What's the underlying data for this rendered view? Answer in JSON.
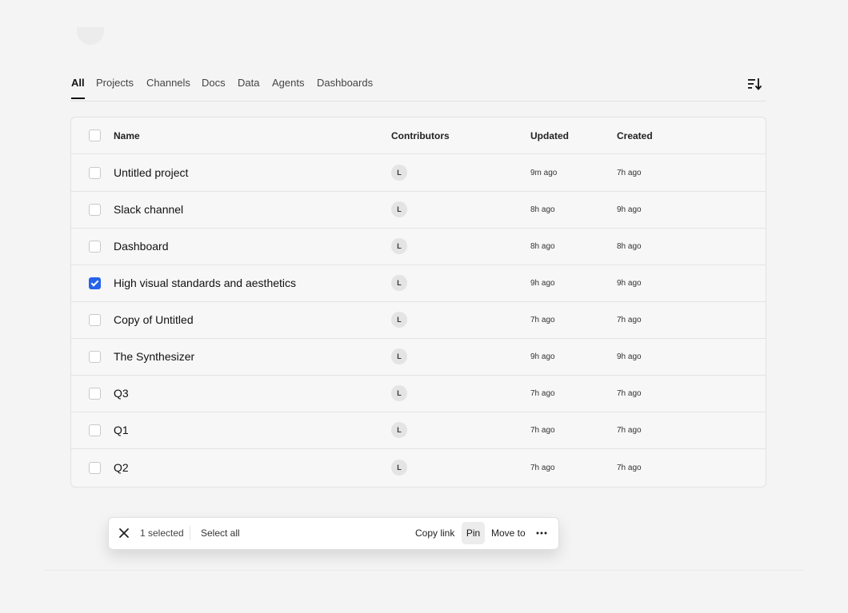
{
  "tabs": [
    {
      "label": "All",
      "active": true
    },
    {
      "label": "Projects"
    },
    {
      "label": "Channels"
    },
    {
      "label": "Docs"
    },
    {
      "label": "Data"
    },
    {
      "label": "Agents"
    },
    {
      "label": "Dashboards"
    }
  ],
  "sort_icon": "sort-descending-icon",
  "table": {
    "headers": {
      "name": "Name",
      "contributors": "Contributors",
      "updated": "Updated",
      "created": "Created"
    },
    "rows": [
      {
        "name": "Untitled project",
        "contributor": "L",
        "updated": "9m ago",
        "created": "7h ago",
        "checked": false
      },
      {
        "name": "Slack channel",
        "contributor": "L",
        "updated": "8h ago",
        "created": "9h ago",
        "checked": false
      },
      {
        "name": "Dashboard",
        "contributor": "L",
        "updated": "8h ago",
        "created": "8h ago",
        "checked": false
      },
      {
        "name": "High visual standards and aesthetics",
        "contributor": "L",
        "updated": "9h ago",
        "created": "9h ago",
        "checked": true
      },
      {
        "name": "Copy of Untitled",
        "contributor": "L",
        "updated": "7h ago",
        "created": "7h ago",
        "checked": false
      },
      {
        "name": "The Synthesizer",
        "contributor": "L",
        "updated": "9h ago",
        "created": "9h ago",
        "checked": false
      },
      {
        "name": "Q3",
        "contributor": "L",
        "updated": "7h ago",
        "created": "7h ago",
        "checked": false
      },
      {
        "name": "Q1",
        "contributor": "L",
        "updated": "7h ago",
        "created": "7h ago",
        "checked": false
      },
      {
        "name": "Q2",
        "contributor": "L",
        "updated": "7h ago",
        "created": "7h ago",
        "checked": false
      }
    ]
  },
  "action_bar": {
    "selected_text": "1 selected",
    "select_all": "Select all",
    "copy_link": "Copy link",
    "pin": "Pin",
    "move_to": "Move to"
  },
  "colors": {
    "accent": "#2563eb",
    "background": "#f4f4f4"
  }
}
